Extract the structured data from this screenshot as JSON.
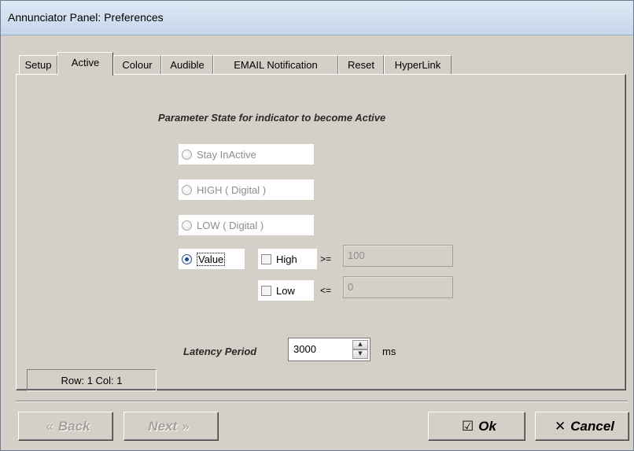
{
  "window": {
    "title": "Annunciator Panel: Preferences"
  },
  "tabs": [
    {
      "label": "Setup"
    },
    {
      "label": "Active"
    },
    {
      "label": "Colour"
    },
    {
      "label": "Audible"
    },
    {
      "label": "EMAIL Notification"
    },
    {
      "label": "Reset"
    },
    {
      "label": "HyperLink"
    }
  ],
  "active_tab": "Active",
  "panel": {
    "heading": "Parameter State for indicator to become Active",
    "options": [
      {
        "label": "Stay InActive",
        "checked": false,
        "enabled": false
      },
      {
        "label": "HIGH ( Digital )",
        "checked": false,
        "enabled": false
      },
      {
        "label": "LOW ( Digital )",
        "checked": false,
        "enabled": false
      },
      {
        "label": "Value",
        "checked": true,
        "enabled": true
      }
    ],
    "high": {
      "label": "High",
      "checked": false,
      "operator": ">=",
      "value": "100"
    },
    "low": {
      "label": "Low",
      "checked": false,
      "operator": "<=",
      "value": "0"
    },
    "latency": {
      "label": "Latency Period",
      "value": "3000",
      "unit": "ms"
    }
  },
  "status": {
    "row_col": "Row: 1 Col: 1"
  },
  "buttons": {
    "back": {
      "label": "Back",
      "icon": "double-chevron-left-icon",
      "enabled": false
    },
    "next": {
      "label": "Next",
      "icon": "double-chevron-right-icon",
      "enabled": false
    },
    "ok": {
      "label": "Ok",
      "icon": "checkmark-box-icon",
      "enabled": true
    },
    "cancel": {
      "label": "Cancel",
      "icon": "close-icon",
      "enabled": true
    }
  }
}
